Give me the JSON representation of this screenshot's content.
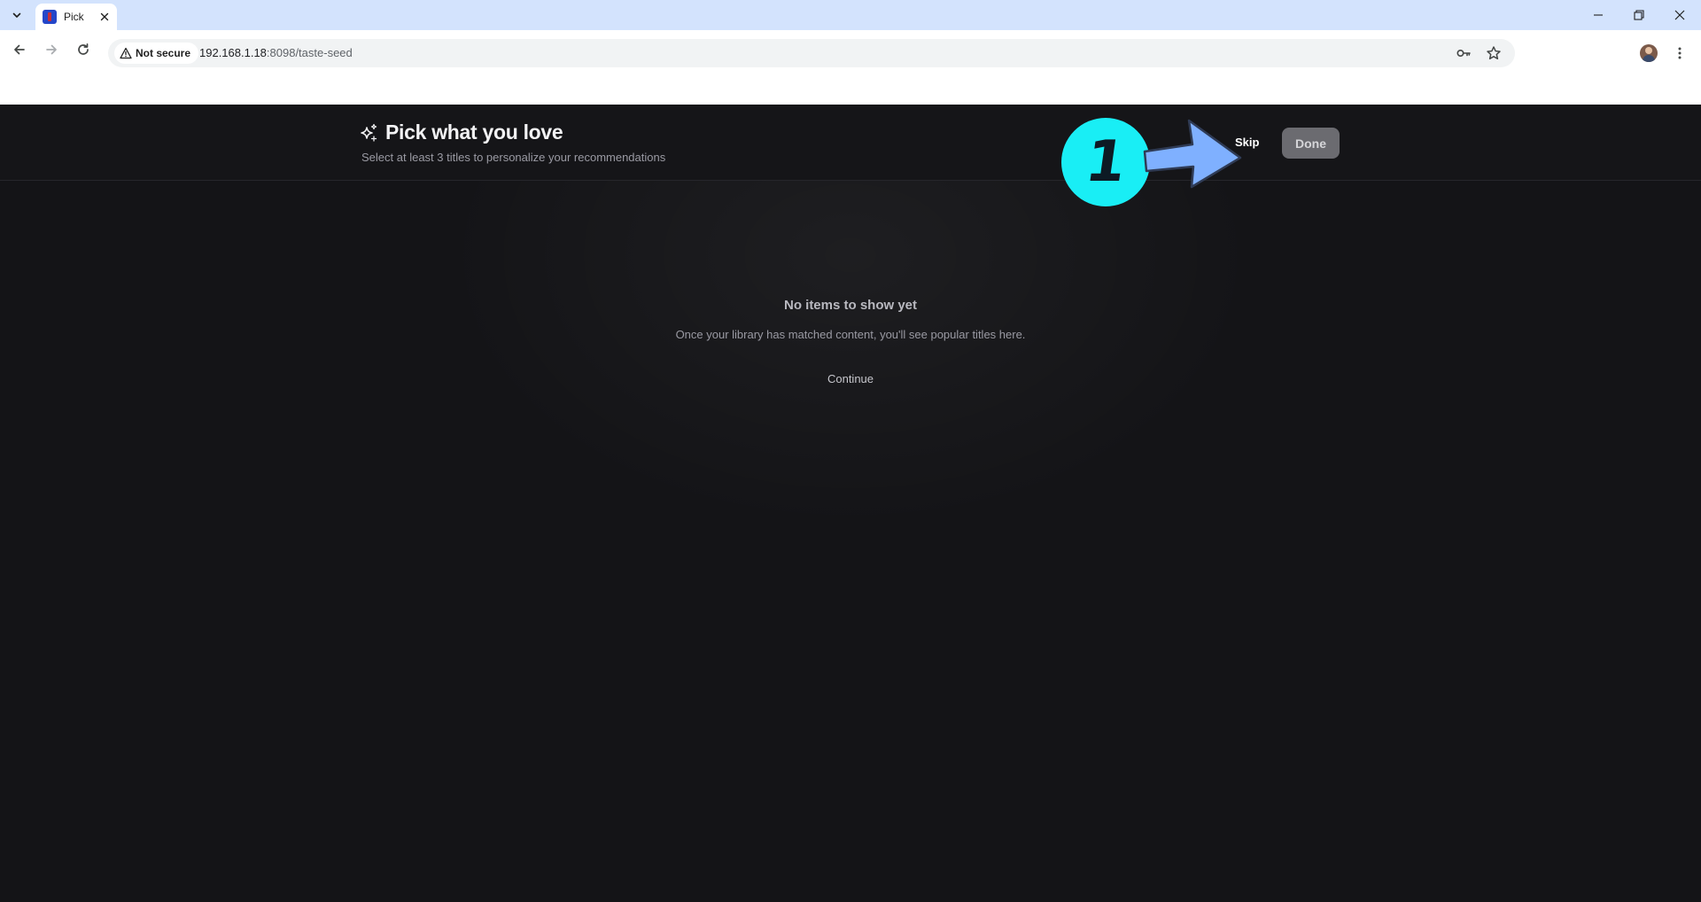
{
  "browser": {
    "tab_title": "Pick what you love",
    "security_label": "Not secure",
    "url_host": "192.168.1.18",
    "url_path": ":8098/taste-seed"
  },
  "page": {
    "title": "Pick what you love",
    "subtitle": "Select at least 3 titles to personalize your recommendations",
    "skip_label": "Skip",
    "done_label": "Done",
    "empty_title": "No items to show yet",
    "empty_description": "Once your library has matched content, you'll see popular titles here.",
    "continue_label": "Continue"
  },
  "annotation": {
    "step_number": "1",
    "badge_color": "#19eef5",
    "arrow_color": "#7fb0ff"
  },
  "icons": {
    "title_icon": "sparkles-icon"
  }
}
